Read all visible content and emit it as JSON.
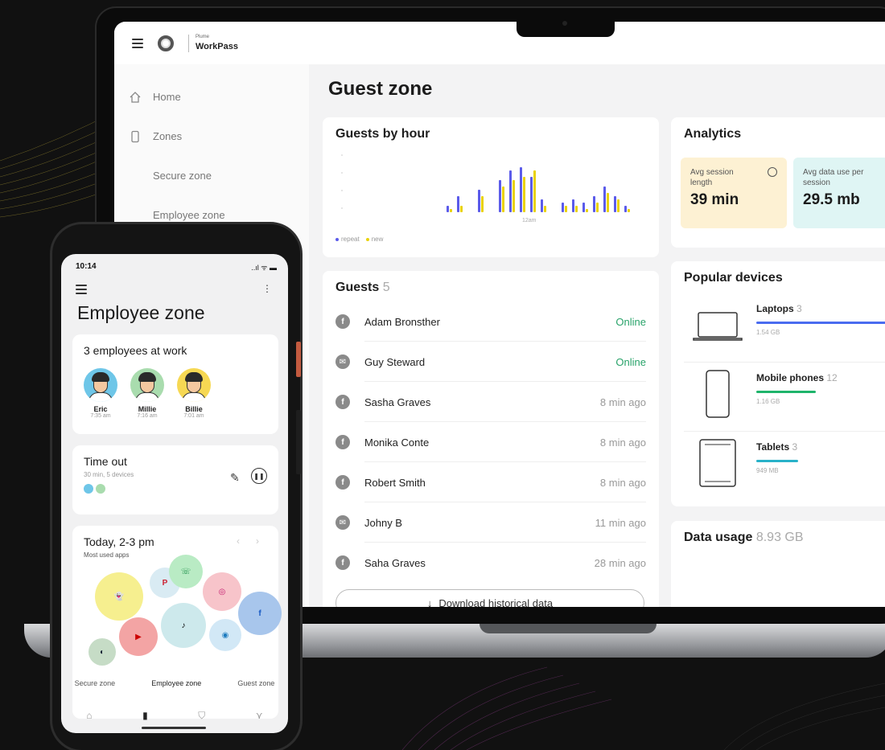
{
  "app": {
    "brand_small": "Plume",
    "brand_name": "WorkPass"
  },
  "sidebar": {
    "items": [
      {
        "label": "Home",
        "icon": "home-icon"
      },
      {
        "label": "Zones",
        "icon": "phone-icon"
      },
      {
        "label": "Secure zone"
      },
      {
        "label": "Employee zone"
      }
    ]
  },
  "main": {
    "title": "Guest zone",
    "guests_by_hour": {
      "title": "Guests by hour",
      "legend": {
        "repeat": "repeat",
        "new": "new"
      },
      "tick_labels": [
        "",
        "",
        "12am",
        "",
        ""
      ],
      "colors": {
        "repeat": "#5b5bea",
        "new": "#e9d20a"
      }
    },
    "guests": {
      "title": "Guests",
      "count": "5",
      "rows": [
        {
          "name": "Adam Bronsther",
          "status": "Online",
          "avatar": "f"
        },
        {
          "name": "Guy Steward",
          "status": "Online",
          "avatar": "✉"
        },
        {
          "name": "Sasha Graves",
          "status": "8 min ago",
          "avatar": "f"
        },
        {
          "name": "Monika Conte",
          "status": "8 min ago",
          "avatar": "f"
        },
        {
          "name": "Robert Smith",
          "status": "8 min ago",
          "avatar": "f"
        },
        {
          "name": "Johny B",
          "status": "11 min ago",
          "avatar": "✉"
        },
        {
          "name": "Saha Graves",
          "status": "28 min ago",
          "avatar": "f"
        }
      ],
      "download_label": "Download historical data"
    },
    "analytics": {
      "title": "Analytics",
      "stats": [
        {
          "label": "Avg session length",
          "value": "39 min",
          "color": "#fdf1d3"
        },
        {
          "label": "Avg data use per session",
          "value": "29.5 mb",
          "color": "#dff5f4"
        }
      ]
    },
    "popular_devices": {
      "title": "Popular devices",
      "devices": [
        {
          "name": "Laptops",
          "count": "3",
          "size": "1.54 GB",
          "fill": 0.9,
          "color": "#4a6cf0"
        },
        {
          "name": "Mobile phones",
          "count": "12",
          "size": "1.16 GB",
          "fill": 0.37,
          "color": "#1fb46b"
        },
        {
          "name": "Tablets",
          "count": "3",
          "size": "949 MB",
          "fill": 0.26,
          "color": "#29b2c9"
        }
      ]
    },
    "data_usage": {
      "title": "Data usage",
      "value": "8.93 GB"
    }
  },
  "phone": {
    "time": "10:14",
    "status_icons": "..ıl ᯤ ▬",
    "title": "Employee zone",
    "at_work": {
      "title": "3 employees at work",
      "employees": [
        {
          "name": "Eric",
          "time": "7:35 am",
          "bg": "#6ec6e8"
        },
        {
          "name": "Millie",
          "time": "7:16 am",
          "bg": "#a9dcae"
        },
        {
          "name": "Billie",
          "time": "7:01 am",
          "bg": "#f6d853"
        }
      ]
    },
    "time_out": {
      "title": "Time out",
      "subtitle": "30 min, 5 devices"
    },
    "today": {
      "title": "Today, 2-3 pm",
      "subtitle": "Most used apps"
    },
    "zone_tabs": [
      "Secure zone",
      "Employee zone",
      "Guest zone"
    ],
    "active_zone": "Employee zone"
  }
}
